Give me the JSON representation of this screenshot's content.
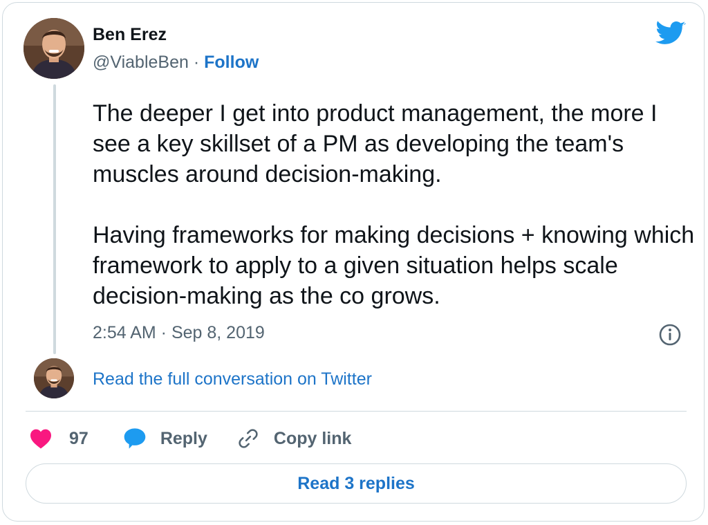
{
  "author": {
    "name": "Ben Erez",
    "handle": "@ViableBen",
    "separator": "·",
    "follow_label": "Follow"
  },
  "tweet": {
    "text": "The deeper I get into product management, the more I see a key skillset of a PM as developing the team's muscles around decision-making.\n\nHaving frameworks for making decisions + knowing which framework to apply to a given situation helps scale decision-making as the co grows.",
    "timestamp": "2:54 AM · Sep 8, 2019"
  },
  "conversation_link": "Read the full conversation on Twitter",
  "actions": {
    "like_count": "97",
    "reply_label": "Reply",
    "copy_label": "Copy link"
  },
  "read_replies_label": "Read 3 replies",
  "icons": {
    "brand": "twitter-bird-icon",
    "like": "heart-icon",
    "reply": "speech-bubble-icon",
    "copy": "link-icon",
    "info": "info-icon"
  },
  "colors": {
    "link": "#1d74c8",
    "twitter_blue": "#1d9bf0",
    "like": "#f91880",
    "secondary_text": "#536471",
    "border": "#cfd9de"
  }
}
